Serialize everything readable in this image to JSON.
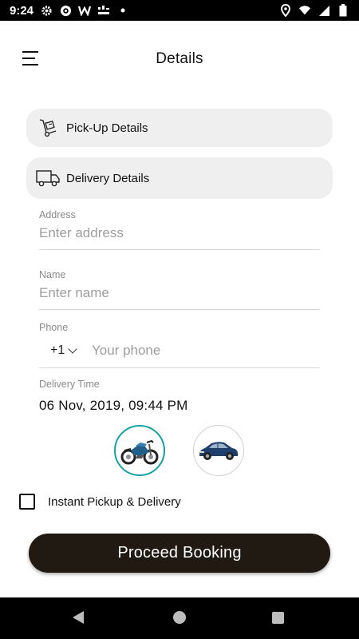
{
  "status_bar": {
    "time": "9:24",
    "left_icons": [
      "gear-icon",
      "circle-app-icon",
      "w-app-icon",
      "grid-app-icon",
      "dot-icon"
    ],
    "right_icons": [
      "location-icon",
      "wifi-icon",
      "signal-icon",
      "battery-icon"
    ]
  },
  "header": {
    "title": "Details"
  },
  "sections": {
    "pickup_label": "Pick-Up Details",
    "delivery_label": "Delivery Details"
  },
  "form": {
    "address_label": "Address",
    "address_placeholder": "Enter address",
    "name_label": "Name",
    "name_placeholder": "Enter name",
    "phone_label": "Phone",
    "country_code": "+1",
    "phone_placeholder": "Your phone",
    "delivery_time_label": "Delivery Time",
    "delivery_time_value": "06 Nov, 2019, 09:44 PM"
  },
  "vehicles": [
    {
      "name": "motorbike",
      "selected": true
    },
    {
      "name": "car",
      "selected": false
    }
  ],
  "instant": {
    "label": "Instant Pickup & Delivery",
    "checked": false
  },
  "proceed_button": {
    "label": "Proceed Booking"
  },
  "colors": {
    "accent_teal": "#12a2a4",
    "button_dark": "#201a12",
    "pill_bg": "#efefef"
  }
}
